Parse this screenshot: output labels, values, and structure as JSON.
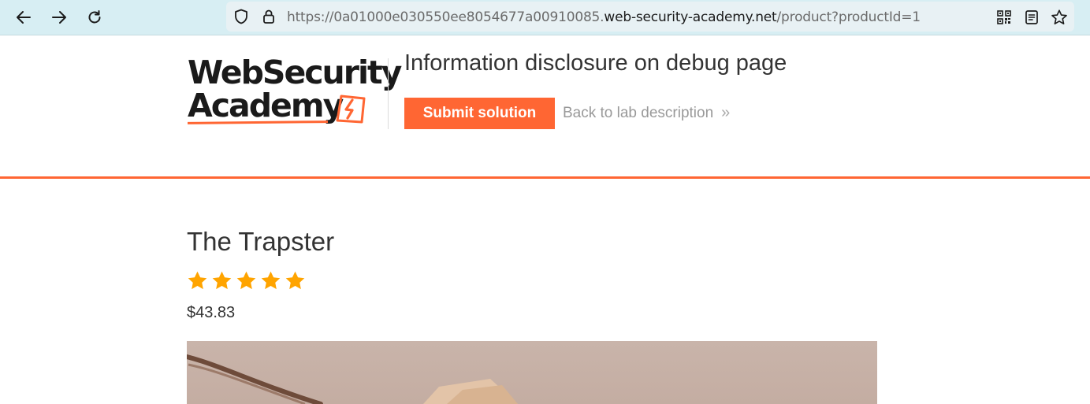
{
  "browser": {
    "url_prefix": "https://0a01000e030550ee8054677a00910085.",
    "url_host": "web-security-academy.net",
    "url_path": "/product?productId=1",
    "icons": [
      "back-arrow-icon",
      "forward-arrow-icon",
      "reload-icon",
      "shield-icon",
      "lock-icon",
      "qr-code-icon",
      "reader-view-icon",
      "bookmark-star-icon"
    ]
  },
  "header": {
    "logo_line1": "WebSecurity",
    "logo_line2": "Academy",
    "lab_title": "Information disclosure on debug page",
    "submit_label": "Submit solution",
    "back_label": "Back to lab description",
    "back_chevron": "»"
  },
  "product": {
    "name": "The Trapster",
    "rating": 5,
    "rating_max": 5,
    "price": "$43.83"
  },
  "colors": {
    "accent": "#ff6633",
    "star": "#ffa400",
    "chrome": "#d7eef3",
    "text": "#333333",
    "muted": "#999999"
  }
}
